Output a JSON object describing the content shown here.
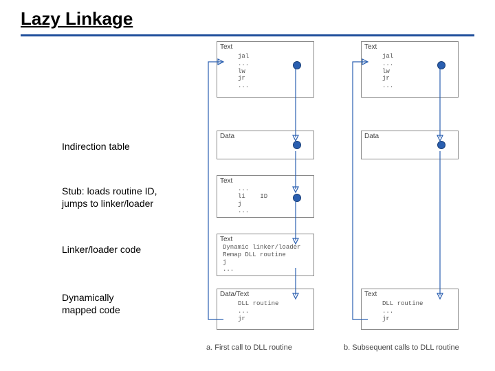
{
  "title": "Lazy Linkage",
  "labels": {
    "indirection": "Indirection table",
    "stub": "Stub: loads routine ID,\njumps to linker/loader",
    "linker": "Linker/loader code",
    "mapped": "Dynamically\nmapped code"
  },
  "captions": {
    "a": "a. First call to DLL routine",
    "b": "b. Subsequent calls to DLL routine"
  },
  "panelA": {
    "text": {
      "title": "Text",
      "code": "jal\n...\nlw\njr\n..."
    },
    "data": {
      "title": "Data"
    },
    "stub": {
      "title": "Text",
      "code": "...\nli    ID\nj\n..."
    },
    "linker": {
      "title": "Text",
      "code": "Dynamic linker/loader\nRemap DLL routine\nj\n..."
    },
    "dll": {
      "title": "Data/Text",
      "code": "DLL routine\n...\njr"
    }
  },
  "panelB": {
    "text": {
      "title": "Text",
      "code": "jal\n...\nlw\njr\n..."
    },
    "data": {
      "title": "Data"
    },
    "dll": {
      "title": "Text",
      "code": "DLL routine\n...\njr"
    }
  }
}
